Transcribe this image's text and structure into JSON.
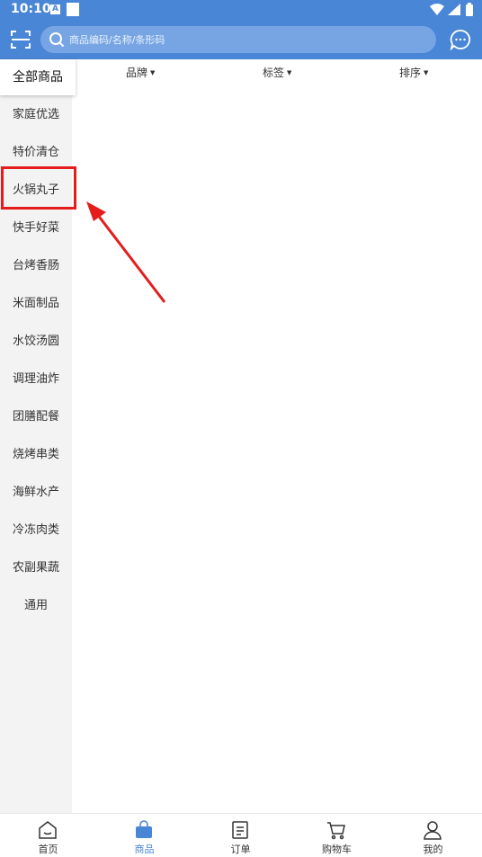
{
  "status_bar": {
    "time": "10:10",
    "notif_letter": "A"
  },
  "header": {
    "search_placeholder": "商品编码/名称/条形码"
  },
  "sidebar": {
    "items": [
      {
        "label": "全部商品"
      },
      {
        "label": "家庭优选"
      },
      {
        "label": "特价清仓"
      },
      {
        "label": "火锅丸子"
      },
      {
        "label": "快手好菜"
      },
      {
        "label": "台烤香肠"
      },
      {
        "label": "米面制品"
      },
      {
        "label": "水饺汤圆"
      },
      {
        "label": "调理油炸"
      },
      {
        "label": "团膳配餐"
      },
      {
        "label": "烧烤串类"
      },
      {
        "label": "海鲜水产"
      },
      {
        "label": "冷冻肉类"
      },
      {
        "label": "农副果蔬"
      },
      {
        "label": "通用"
      }
    ]
  },
  "filters": {
    "brand": "品牌",
    "tag": "标签",
    "sort": "排序"
  },
  "tabbar": {
    "tabs": [
      {
        "label": "首页",
        "icon": "home-icon"
      },
      {
        "label": "商品",
        "icon": "bag-icon"
      },
      {
        "label": "订单",
        "icon": "order-icon"
      },
      {
        "label": "购物车",
        "icon": "cart-icon"
      },
      {
        "label": "我的",
        "icon": "user-icon"
      }
    ]
  },
  "colors": {
    "primary": "#4a86d6",
    "highlight": "#e41c1c",
    "sidebar_bg": "#f3f3f3"
  }
}
